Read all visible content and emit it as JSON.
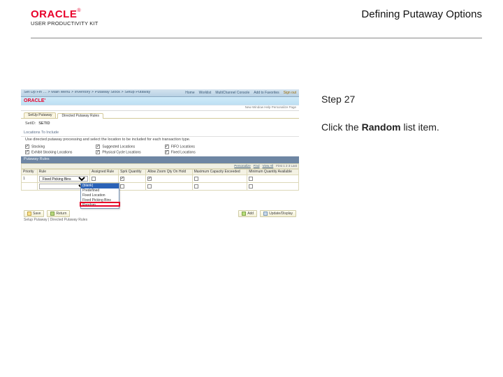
{
  "header": {
    "brand": "ORACLE",
    "reg": "®",
    "suite": "USER PRODUCTIVITY KIT",
    "title": "Defining Putaway Options"
  },
  "instruction": {
    "step_label": "Step 27",
    "before": "Click the ",
    "bold": "Random",
    "after": " list item."
  },
  "shot": {
    "breadcrumb": "Set Up Fin … > Main Menu > Inventory > Putaway Stock > Setup Putaway",
    "nav_links": [
      "Home",
      "Worklist",
      "MultiChannel Console",
      "Add to Favorites",
      "Sign out"
    ],
    "brand": "ORACLE'",
    "subheader": "New Window  Help  Personalize Page",
    "tabs": [
      "SetUp Putaway",
      "Directed Putaway Rules"
    ],
    "setid": {
      "label": "SetID:",
      "value": "SETID"
    },
    "sec_title": "Locations To Include",
    "sec_note": "Use directed putaway processing and select the location to be included for each transaction type.",
    "check_cols": [
      [
        "Stocking",
        "Exhibit Stocking Locations"
      ],
      [
        "Suggested Locations",
        "Physical Cycle Locations"
      ],
      [
        "FIFO Locations",
        "Fixed Locations"
      ]
    ],
    "bar_title": "Putaway Rules",
    "toolbar_links": [
      "Personalize",
      "Find",
      "View All"
    ],
    "toolbar_paging": "First   1  2  3   Last",
    "columns": [
      "Priority",
      "Rule",
      "Assigned Rule",
      "Sprk Quantity",
      "Allow Zoom Qty On Hold",
      "Maximum Capacity Exceeded",
      "Minimum Quantity Available"
    ],
    "row1_priority": "1",
    "row1_rule": "Fixed Picking Bins",
    "dropdown_options": [
      "(blank)",
      "Predefined",
      "Fixed Location",
      "Fixed Picking Bins",
      "Random"
    ],
    "buttons": {
      "save": "Save",
      "return": "Return",
      "add": "Add",
      "update": "Update/Display"
    },
    "status": "Setup Putaway | Directed Putaway Rules"
  }
}
